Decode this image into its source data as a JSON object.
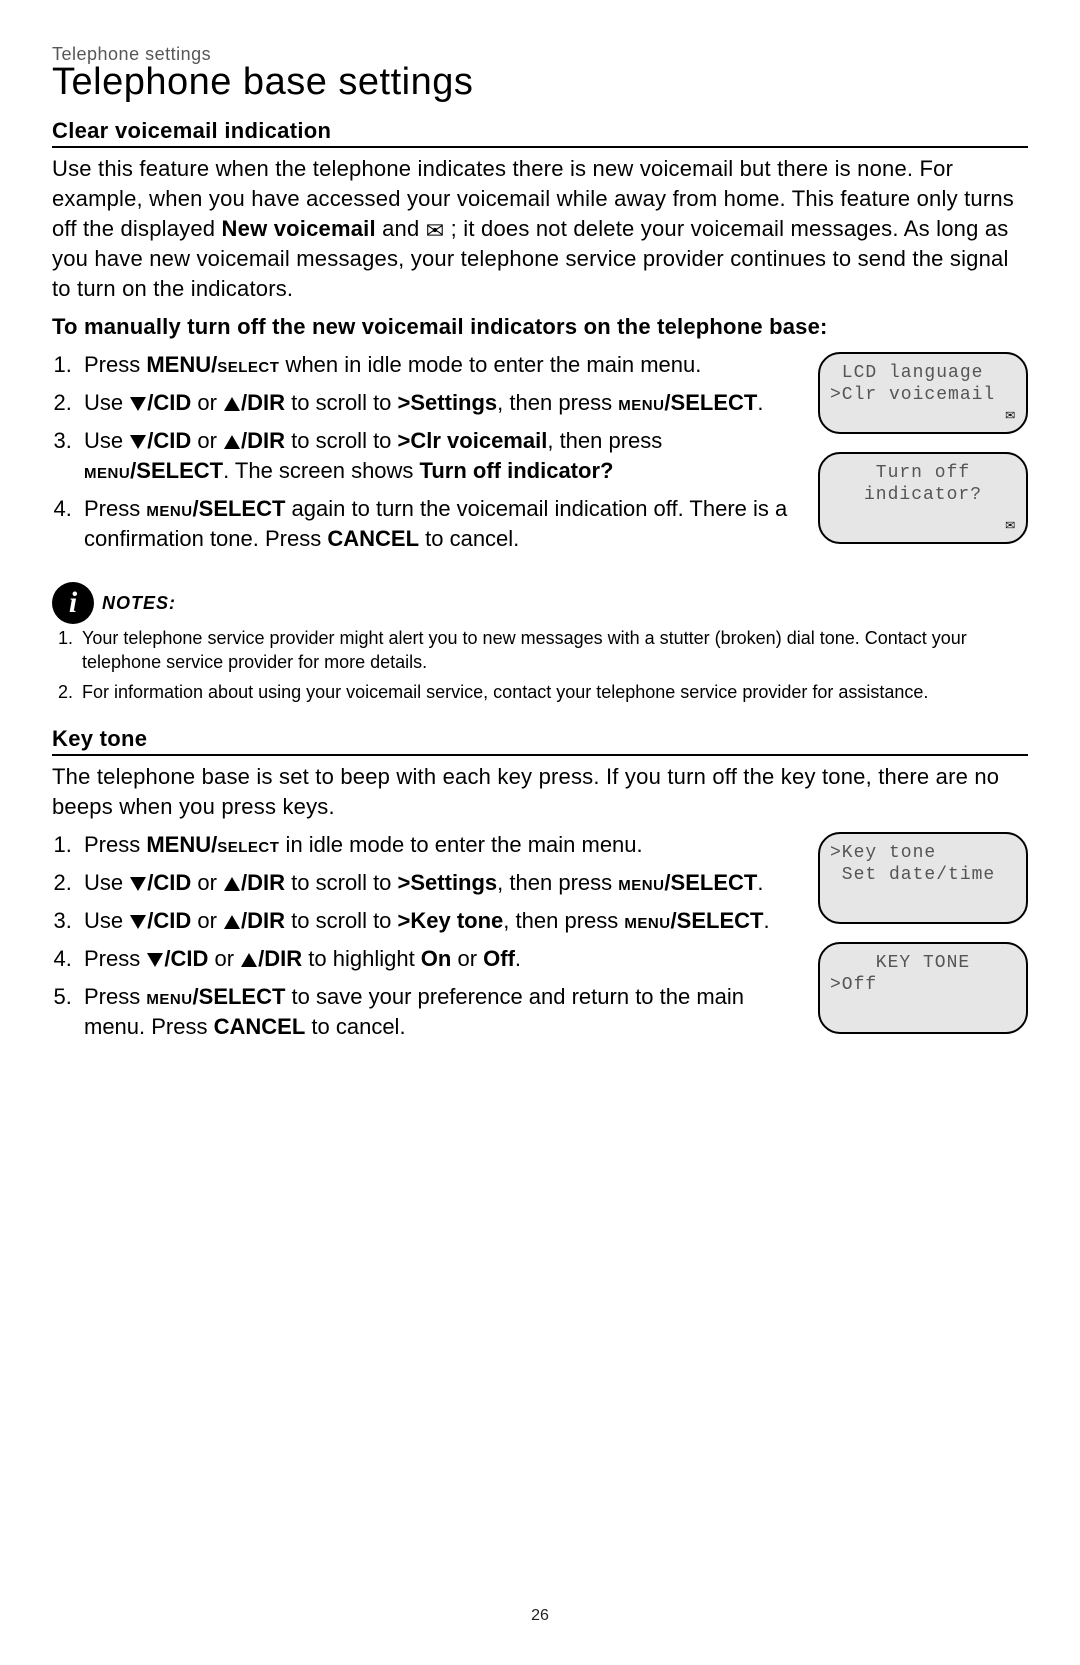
{
  "breadcrumb": "Telephone settings",
  "pageTitle": "Telephone base settings",
  "pageNumber": "26",
  "clearVm": {
    "heading": "Clear voicemail indication",
    "intro_a": "Use this feature when the telephone indicates there is new voicemail but there is none. For example, when you have accessed your voicemail while away from home. This feature only turns off the displayed ",
    "intro_bold": "New voicemail",
    "intro_b": " and ",
    "intro_c": " ; it does not delete your voicemail messages. As long as you have new voicemail messages, your telephone service provider continues to send the signal to turn on the indicators.",
    "procTitle": "To manually turn off the new voicemail indicators on the telephone base:",
    "steps": {
      "s1_a": "Press ",
      "s1_b": "MENU/",
      "s1_c": "select",
      "s1_d": " when in idle mode to enter the main menu.",
      "s2_a": "Use ",
      "s2_cid": "/CID",
      "s2_or": " or ",
      "s2_dir": "/DIR",
      "s2_b": " to scroll to ",
      "s2_settings": ">Settings",
      "s2_c": ", then press ",
      "s2_menu": "menu",
      "s2_select": "/SELECT",
      "s2_period": ".",
      "s3_a": "Use ",
      "s3_b": " to scroll to ",
      "s3_clr": ">Clr voicemail",
      "s3_c": ", then press ",
      "s3_d": ". The screen shows ",
      "s3_bold": "Turn off indicator?",
      "s4_a": "Press ",
      "s4_b": " again to turn the voicemail indication off. There is a confirmation tone. Press ",
      "s4_cancel": "CANCEL",
      "s4_c": " to cancel."
    },
    "lcd1_line1": " LCD language",
    "lcd1_line2": ">Clr voicemail",
    "lcd2_line1": "Turn off",
    "lcd2_line2": "indicator?"
  },
  "notes": {
    "label": "NOTES:",
    "n1": "Your telephone service provider might alert you to new messages with a stutter (broken) dial tone. Contact your telephone service provider for more details.",
    "n2": "For information about using your voicemail service, contact your telephone service provider for assistance."
  },
  "keyTone": {
    "heading": "Key tone",
    "intro": "The telephone base is set to beep with each key press. If you turn off the key tone, there are no beeps when you press keys.",
    "steps": {
      "s1_a": "Press ",
      "s1_b": "MENU/",
      "s1_c": "select",
      "s1_d": " in idle mode to enter the main menu.",
      "s2_a": "Use ",
      "s2_b": " to scroll to ",
      "s2_settings": ">Settings",
      "s2_c": ", then press ",
      "s2_period": ".",
      "s3_a": "Use ",
      "s3_b": " to scroll to ",
      "s3_kt": ">Key tone",
      "s3_c": ", then press ",
      "s3_period": ".",
      "s4_a": "Press ",
      "s4_b": " to highlight ",
      "s4_on": "On",
      "s4_or": " or ",
      "s4_off": "Off",
      "s4_period": ".",
      "s5_a": "Press ",
      "s5_b": " to save your preference and return to the main menu. Press ",
      "s5_cancel": "CANCEL",
      "s5_c": " to cancel."
    },
    "lcd1_line1": ">Key tone",
    "lcd1_line2": " Set date/time",
    "lcd2_line1": "KEY TONE",
    "lcd2_line2": ">Off"
  }
}
